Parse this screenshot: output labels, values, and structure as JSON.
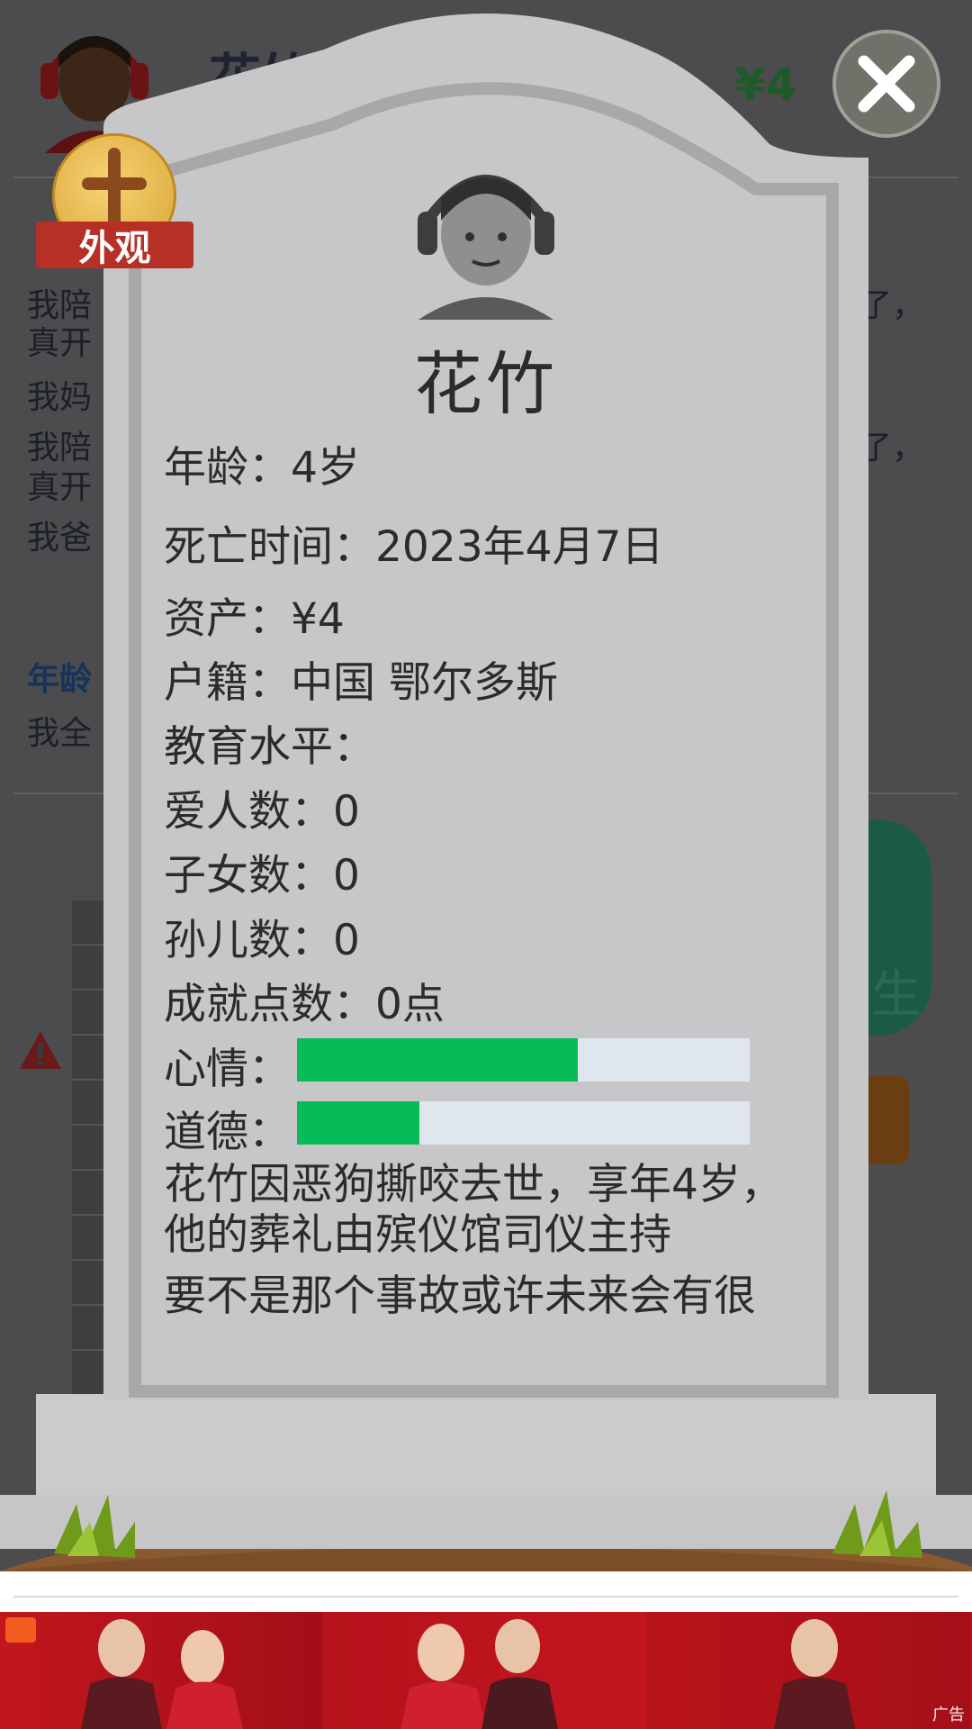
{
  "background": {
    "player_name": "花竹",
    "money": "¥4",
    "lines": [
      "我陪",
      "真开",
      "我妈",
      "我陪",
      "真开",
      "我爸"
    ],
    "line_tail_1": "了，",
    "line_tail_2": "了，",
    "age_heading": "年龄",
    "age_line": "我全",
    "button_text": "生"
  },
  "skin_badge": {
    "label": "外观",
    "icon": "cross-icon"
  },
  "close_button": {
    "icon": "close-icon"
  },
  "tombstone": {
    "name": "花竹",
    "age": {
      "label": "年龄：",
      "value": "4岁"
    },
    "death_time": {
      "label": "死亡时间：",
      "value": "2023年4月7日"
    },
    "assets": {
      "label": "资产：",
      "value": "¥4"
    },
    "hukou": {
      "label": "户籍：",
      "value": "中国 鄂尔多斯"
    },
    "education": {
      "label": "教育水平：",
      "value": ""
    },
    "lovers": {
      "label": "爱人数：",
      "value": "0"
    },
    "children": {
      "label": "子女数：",
      "value": "0"
    },
    "grandchildren": {
      "label": "孙儿数：",
      "value": "0"
    },
    "achievements": {
      "label": "成就点数：",
      "value": "0点"
    },
    "mood": {
      "label": "心情：",
      "level": 0.62
    },
    "morality": {
      "label": "道德：",
      "level": 0.27
    },
    "epitaph_1": "花竹因恶狗撕咬去世，享年4岁，他的葬礼由殡仪馆司仪主持",
    "epitaph_2": "要不是那个事故或许未来会有很"
  },
  "ad": {
    "label": "广告",
    "icon": "ad-logo-icon"
  },
  "colors": {
    "bar_fill": "#07bb57",
    "bar_track": "#dfe6ee",
    "stone": "#c7c7c9",
    "close_bg": "#6e7269"
  }
}
